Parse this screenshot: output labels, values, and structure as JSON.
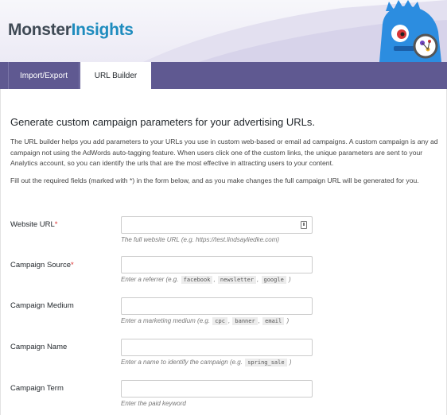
{
  "brand": {
    "word1": "Monster",
    "word2": "Insights"
  },
  "tabs": [
    {
      "label": "Import/Export",
      "active": false
    },
    {
      "label": "URL Builder",
      "active": true
    }
  ],
  "main": {
    "heading": "Generate custom campaign parameters for your advertising URLs.",
    "paragraph1": "The URL builder helps you add parameters to your URLs you use in custom web-based or email ad campaigns. A custom campaign is any ad campaign not using the AdWords auto-tagging feature. When users click one of the custom links, the unique parameters are sent to your Analytics account, so you can identify the urls that are the most effective in attracting users to your content.",
    "paragraph2": "Fill out the required fields (marked with *) in the form below, and as you make changes the full campaign URL will be generated for you."
  },
  "fields": {
    "website_url": {
      "label": "Website URL",
      "required_mark": "*",
      "value": "",
      "help": "The full website URL (e.g. https://test.lindsayliedke.com)"
    },
    "campaign_source": {
      "label": "Campaign Source",
      "required_mark": "*",
      "value": "",
      "help_prefix": "Enter a referrer (e.g.",
      "codes": [
        "facebook",
        "newsletter",
        "google"
      ],
      "help_suffix": ")"
    },
    "campaign_medium": {
      "label": "Campaign Medium",
      "value": "",
      "help_prefix": "Enter a marketing medium (e.g.",
      "codes": [
        "cpc",
        "banner",
        "email"
      ],
      "help_suffix": ")"
    },
    "campaign_name": {
      "label": "Campaign Name",
      "value": "",
      "help_prefix": "Enter a name to identify the campaign (e.g.",
      "codes": [
        "spring_sale"
      ],
      "help_suffix": ")"
    },
    "campaign_term": {
      "label": "Campaign Term",
      "value": "",
      "help": "Enter the paid keyword"
    }
  },
  "colors": {
    "tabbar": "#5f5991",
    "accent_blue": "#1e8cbe",
    "required": "#dc3232"
  },
  "icons": {
    "mascot": "monster-mascot-icon",
    "field_autofill": "contact-card-icon"
  }
}
